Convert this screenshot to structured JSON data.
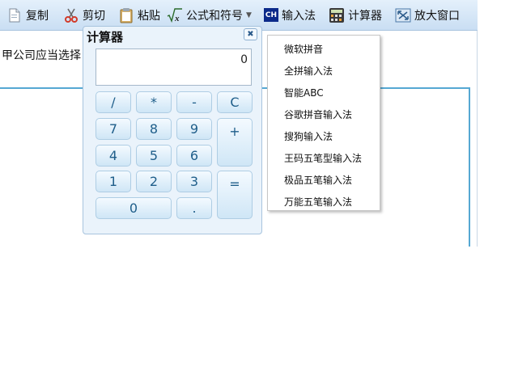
{
  "toolbar": {
    "copy_label": "复制",
    "cut_label": "剪切",
    "paste_label": "粘贴",
    "formula_label": "公式和符号",
    "ime_badge": "CH",
    "ime_label": "输入法",
    "calculator_label": "计算器",
    "zoom_label": "放大窗口"
  },
  "document": {
    "text": "甲公司应当选择"
  },
  "calculator": {
    "title": "计算器",
    "display": "0",
    "keys": {
      "div": "/",
      "mul": "*",
      "sub": "-",
      "clear": "C",
      "k7": "7",
      "k8": "8",
      "k9": "9",
      "add": "+",
      "k4": "4",
      "k5": "5",
      "k6": "6",
      "k1": "1",
      "k2": "2",
      "k3": "3",
      "eq": "=",
      "k0": "0",
      "dot": "."
    }
  },
  "ime_menu": {
    "items": [
      "微软拼音",
      "全拼输入法",
      "智能ABC",
      "谷歌拼音输入法",
      "搜狗输入法",
      "王码五笔型输入法",
      "极品五笔输入法",
      "万能五笔输入法"
    ]
  },
  "colors": {
    "toolbar_top": "#e4f0fb",
    "toolbar_bottom": "#c9def3",
    "frame_border": "#55a8d3",
    "key_text": "#1f5e8a",
    "ime_badge_bg": "#0b2a8a"
  }
}
